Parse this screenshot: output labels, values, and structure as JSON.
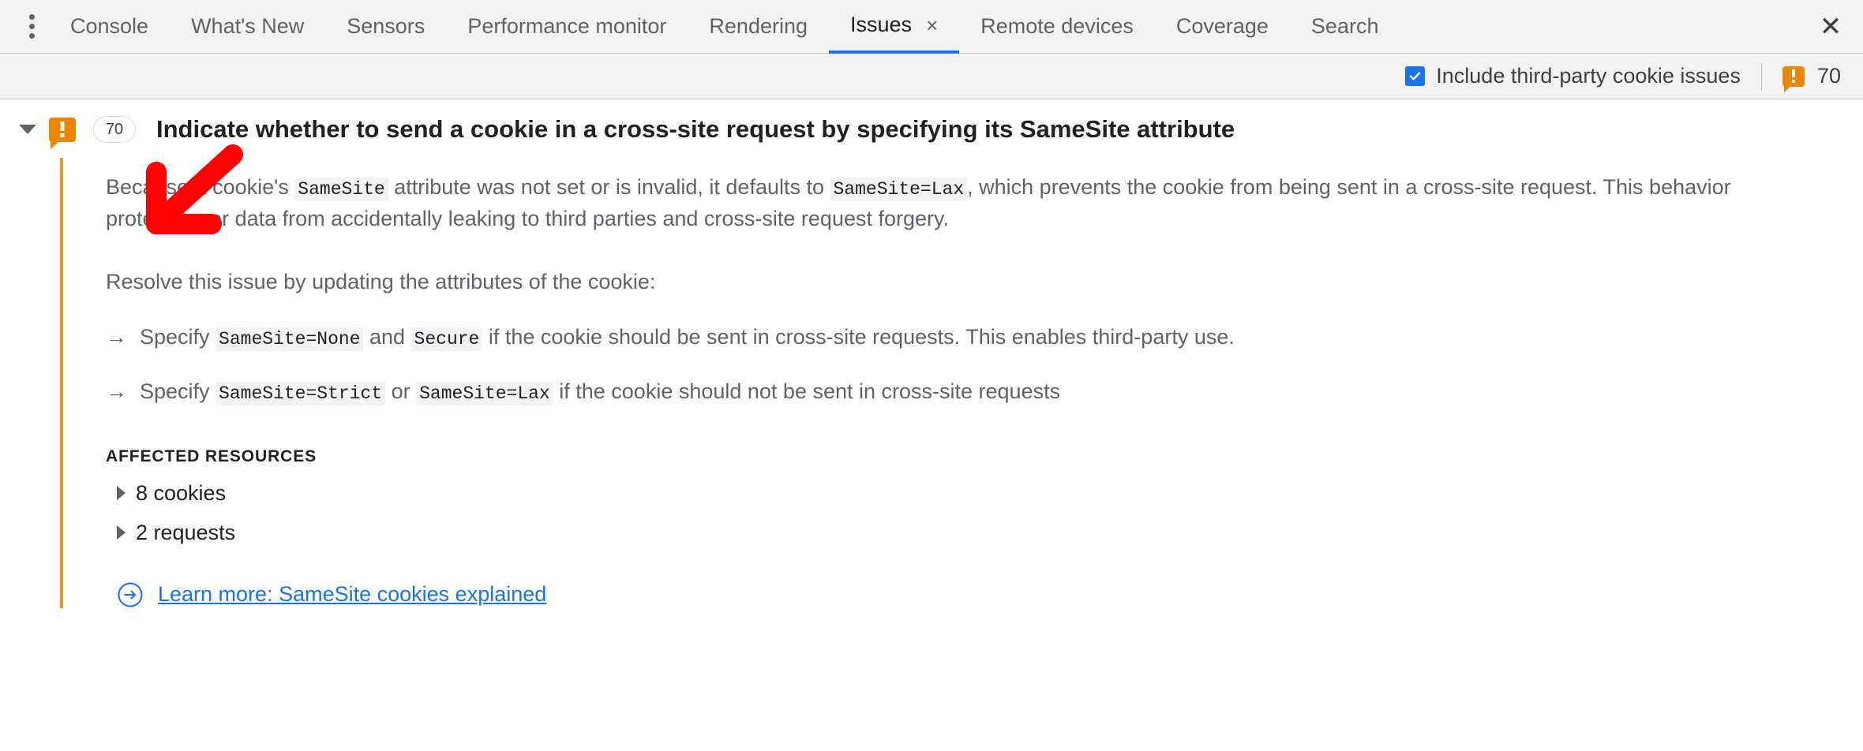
{
  "devtools": {
    "menu_icon": "kebab-menu-icon",
    "tabs": [
      {
        "label": "Console",
        "active": false,
        "closable": false
      },
      {
        "label": "What's New",
        "active": false,
        "closable": false
      },
      {
        "label": "Sensors",
        "active": false,
        "closable": false
      },
      {
        "label": "Performance monitor",
        "active": false,
        "closable": false
      },
      {
        "label": "Rendering",
        "active": false,
        "closable": false
      },
      {
        "label": "Issues",
        "active": true,
        "closable": true
      },
      {
        "label": "Remote devices",
        "active": false,
        "closable": false
      },
      {
        "label": "Coverage",
        "active": false,
        "closable": false
      },
      {
        "label": "Search",
        "active": false,
        "closable": false
      }
    ],
    "tab_close_glyph": "×",
    "panel_close_glyph": "✕"
  },
  "toolbar": {
    "third_party_checkbox": {
      "label": "Include third-party cookie issues",
      "checked": true
    },
    "issue_count": "70",
    "warning_icon": "warning-bubble-icon"
  },
  "issue": {
    "expanded": true,
    "count_badge": "70",
    "title": "Indicate whether to send a cookie in a cross-site request by specifying its SameSite attribute",
    "paragraph1": {
      "part1": "Because a cookie's ",
      "code1": "SameSite",
      "part2": " attribute was not set or is invalid, it defaults to ",
      "code2": "SameSite=Lax",
      "part3": ", which prevents the cookie from being sent in a cross-site request. This behavior protects user data from accidentally leaking to third parties and cross-site request forgery."
    },
    "paragraph2": "Resolve this issue by updating the attributes of the cookie:",
    "bullets": [
      {
        "arrow": "→",
        "part1": "Specify ",
        "code1": "SameSite=None",
        "part2": " and ",
        "code2": "Secure",
        "part3": " if the cookie should be sent in cross-site requests. This enables third-party use."
      },
      {
        "arrow": "→",
        "part1": "Specify ",
        "code1": "SameSite=Strict",
        "part2": " or ",
        "code2": "SameSite=Lax",
        "part3": " if the cookie should not be sent in cross-site requests"
      }
    ],
    "affected_resources_label": "Affected resources",
    "resources": [
      {
        "label": "8 cookies"
      },
      {
        "label": "2 requests"
      }
    ],
    "learn_more": {
      "icon": "circled-arrow-icon",
      "text": "Learn more: SameSite cookies explained"
    }
  },
  "annotation": {
    "arrow": "red-down-left-arrow"
  },
  "colors": {
    "accent_blue": "#1a73e8",
    "warning_orange": "#ea8600",
    "issue_border_orange": "#e9972f",
    "annotation_red": "#ff0000",
    "toolbar_bg": "#f3f3f3",
    "text_primary": "#202124",
    "text_secondary": "#5f6368"
  }
}
